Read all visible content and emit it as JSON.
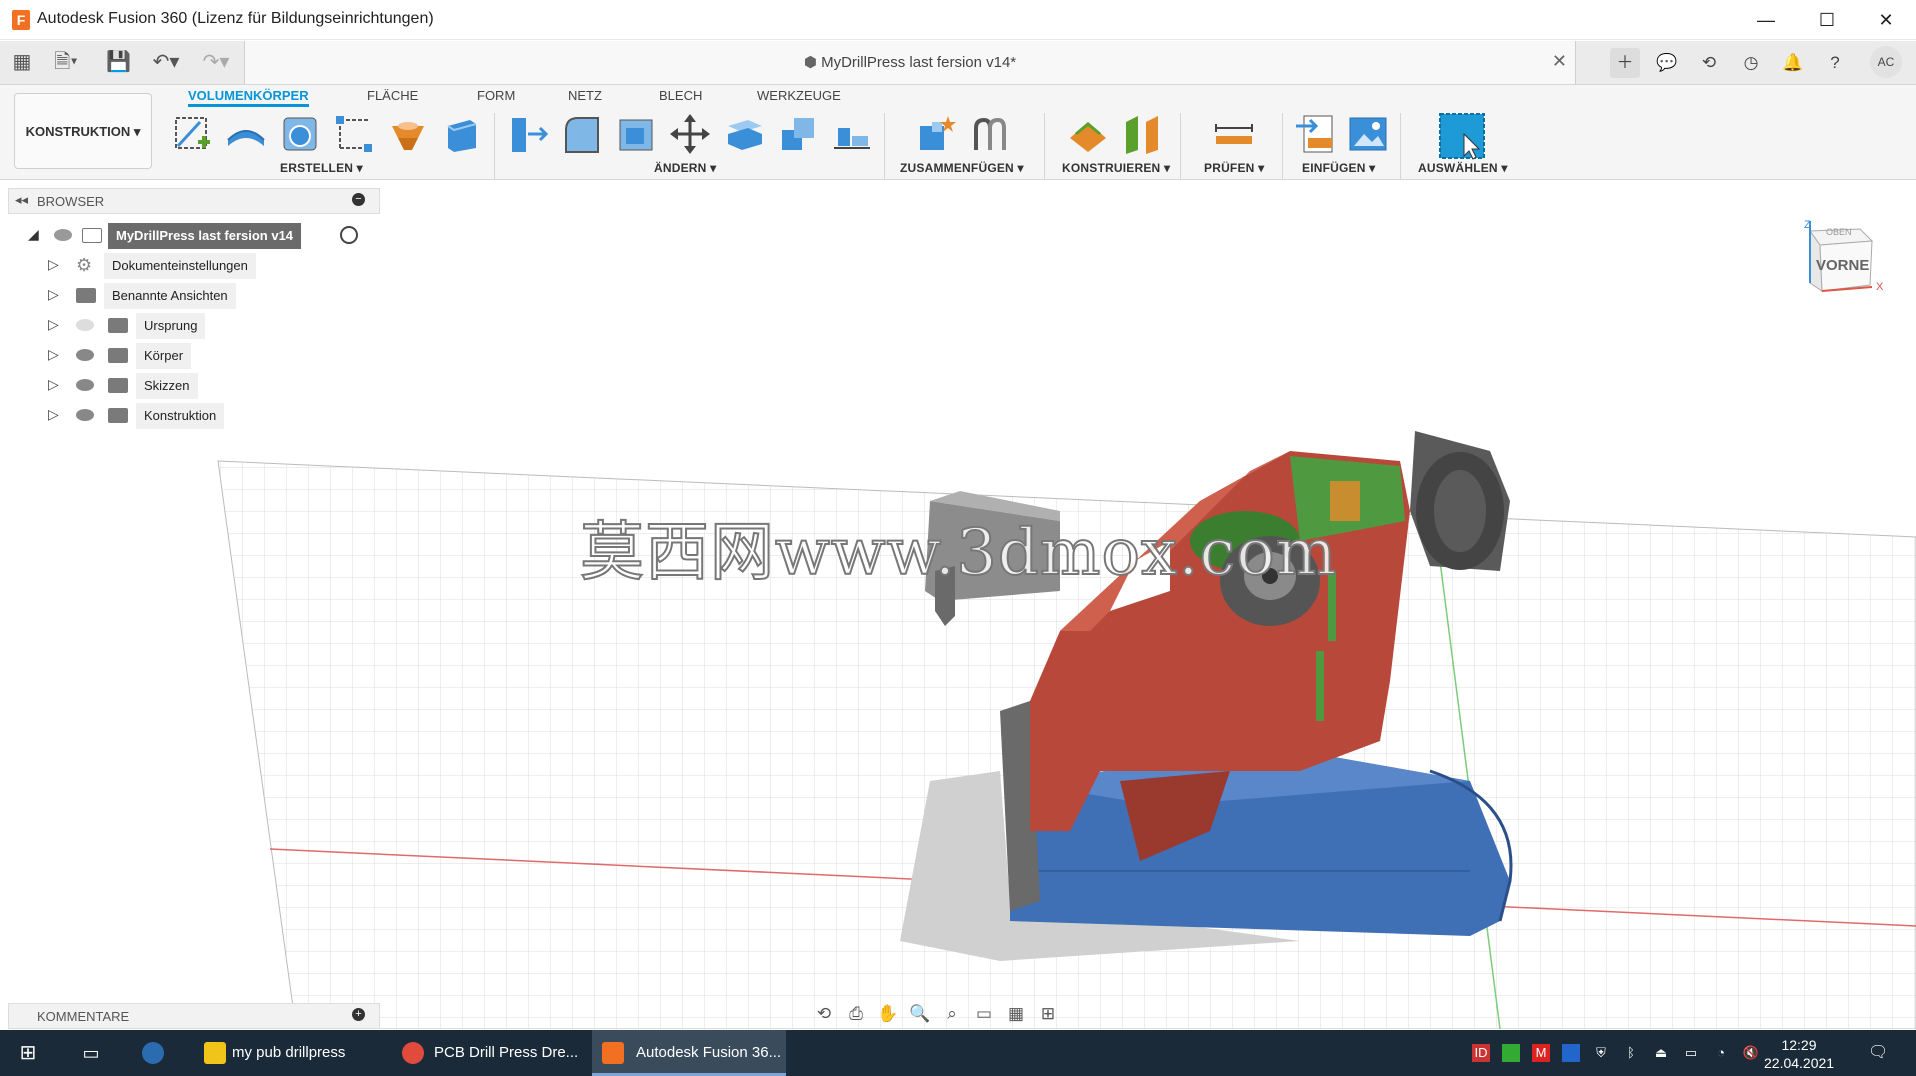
{
  "window": {
    "title": "Autodesk Fusion 360 (Lizenz für Bildungseinrichtungen)",
    "app_icon_letter": "F",
    "controls": {
      "minimize": "—",
      "maximize": "☐",
      "close": "✕"
    }
  },
  "document": {
    "title": "MyDrillPress last fersion v14*",
    "close": "✕"
  },
  "toolbar_right": {
    "user_initials": "AC"
  },
  "ribbon": {
    "workspace": "KONSTRUKTION ▾",
    "tabs": [
      {
        "label": "VOLUMENKÖRPER"
      },
      {
        "label": "FLÄCHE"
      },
      {
        "label": "FORM"
      },
      {
        "label": "NETZ"
      },
      {
        "label": "BLECH"
      },
      {
        "label": "WERKZEUGE"
      }
    ],
    "groups": [
      {
        "label": "ERSTELLEN ▾"
      },
      {
        "label": "ÄNDERN ▾"
      },
      {
        "label": "ZUSAMMENFÜGEN ▾"
      },
      {
        "label": "KONSTRUIEREN ▾"
      },
      {
        "label": "PRÜFEN ▾"
      },
      {
        "label": "EINFÜGEN ▾"
      },
      {
        "label": "AUSWÄHLEN ▾"
      }
    ],
    "icon_colors": {
      "blue": "#3a8fd8",
      "orange": "#e58a2b",
      "green": "#5aa02c",
      "select": "#1e9bd7"
    }
  },
  "browser": {
    "title": "BROWSER",
    "root": "MyDrillPress last fersion v14",
    "items": [
      {
        "label": "Dokumenteinstellungen",
        "icon": "gear-icon"
      },
      {
        "label": "Benannte Ansichten",
        "icon": "folder-icon"
      },
      {
        "label": "Ursprung",
        "icon": "folder-icon",
        "visible": false
      },
      {
        "label": "Körper",
        "icon": "folder-icon",
        "visible": true
      },
      {
        "label": "Skizzen",
        "icon": "folder-icon",
        "visible": true
      },
      {
        "label": "Konstruktion",
        "icon": "folder-icon",
        "visible": true
      }
    ]
  },
  "viewcube": {
    "top": "OBEN",
    "front": "VORNE",
    "axis_z": "Z",
    "axis_x": "X"
  },
  "watermark": "莫西网www.3dmox.com",
  "comments": {
    "title": "KOMMENTARE"
  },
  "taskbar": {
    "items": [
      {
        "label": "my pub drillpress"
      },
      {
        "label": "PCB Drill Press Dre..."
      },
      {
        "label": "Autodesk Fusion 36..."
      }
    ],
    "time": "12:29",
    "date": "22.04.2021"
  },
  "model_colors": {
    "red": "#b8493a",
    "blue": "#3f6fb5",
    "green": "#4f9a40",
    "gray": "#6a6a6a"
  }
}
